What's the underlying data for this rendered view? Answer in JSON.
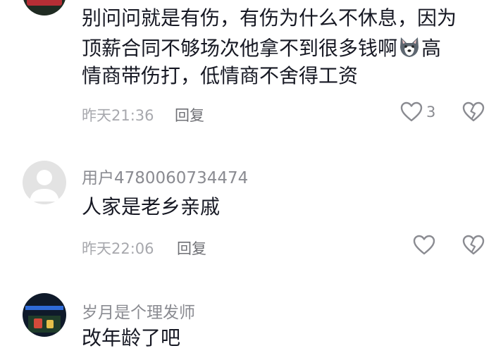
{
  "comments": [
    {
      "text_lines": [
        "别问问就是有伤，有伤为什么不休息，因为",
        "顶薪合同不够场次他拿不到很多钱啊",
        "高",
        "情商带伤打，低情商不舍得工资"
      ],
      "emoji_icon": "husky-dog-emoji",
      "timestamp": "昨天21:36",
      "reply_label": "回复",
      "like_count": "3"
    },
    {
      "username": "用户4780060734474",
      "text": "人家是老乡亲戚",
      "timestamp": "昨天22:06",
      "reply_label": "回复",
      "like_count": ""
    },
    {
      "username": "岁月是个理发师",
      "text": "改年龄了吧"
    }
  ],
  "icons": {
    "like": "heart-outline-icon",
    "dislike": "broken-heart-icon"
  },
  "colors": {
    "text_primary": "#161823",
    "text_secondary": "#8a8b91",
    "icon_gray": "#8a8b91"
  }
}
